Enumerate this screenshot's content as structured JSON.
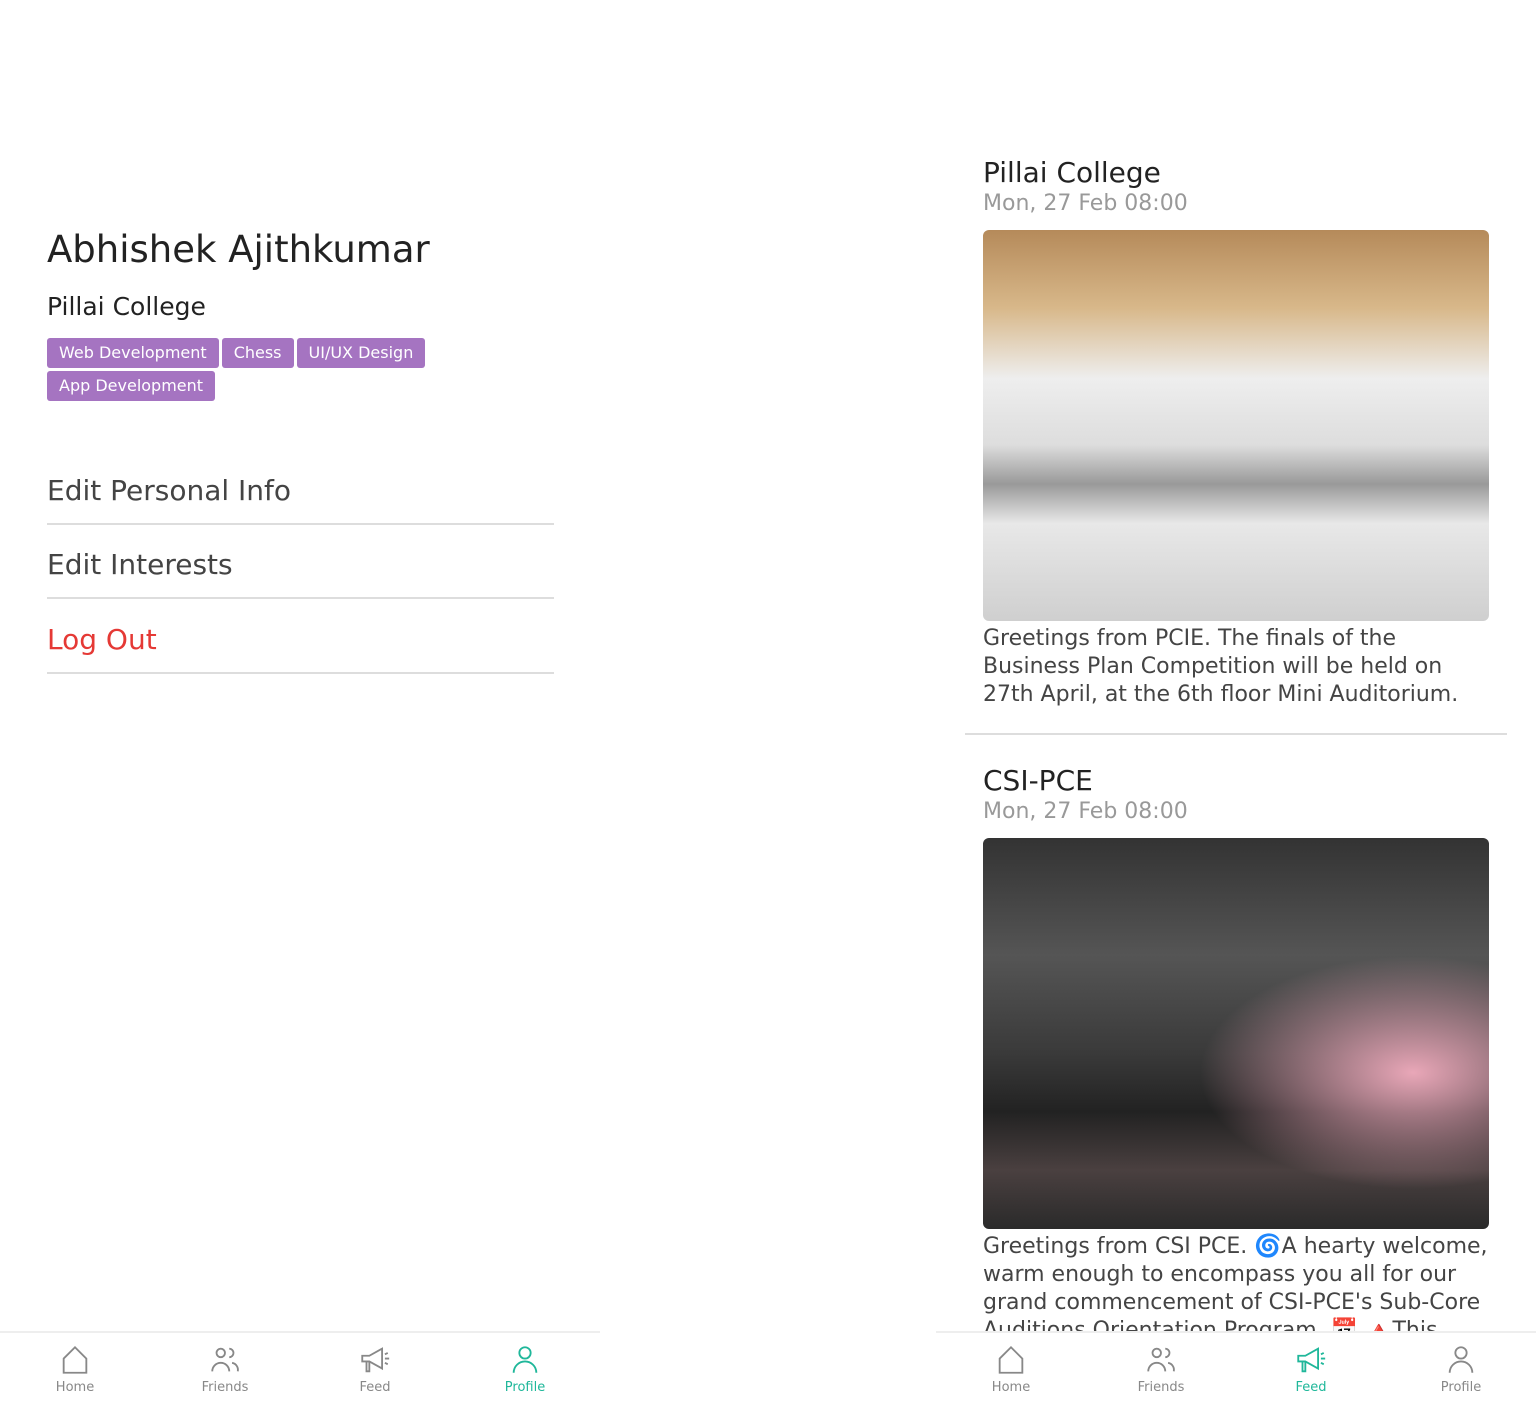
{
  "profile": {
    "name": "Abhishek Ajithkumar",
    "college": "Pillai College",
    "tags": [
      "Web Development",
      "Chess",
      "UI/UX Design",
      "App Development"
    ],
    "tag_color": "#a574c1",
    "menu": [
      "Edit Personal Info",
      "Edit Interests",
      "Log Out"
    ]
  },
  "feed": {
    "posts": [
      {
        "author": "Pillai College",
        "date": "Mon, 27 Feb 08:00",
        "text": "Greetings from PCIE.  The finals of the Business Plan Competition will be held on 27th April, at the 6th floor Mini Auditorium."
      },
      {
        "author": "CSI-PCE",
        "date": "Mon, 27 Feb 08:00",
        "text": "Greetings from CSI PCE. 🌀A hearty welcome, warm enough to encompass you all for our grand commencement of CSI-PCE's Sub-Core Auditions Orientation Program. 📅 🔺This could"
      }
    ]
  },
  "nav": {
    "items": [
      "Home",
      "Friends",
      "Feed",
      "Profile"
    ],
    "active_color": "#1fb79a",
    "left_active": "Profile",
    "right_active": "Feed"
  }
}
